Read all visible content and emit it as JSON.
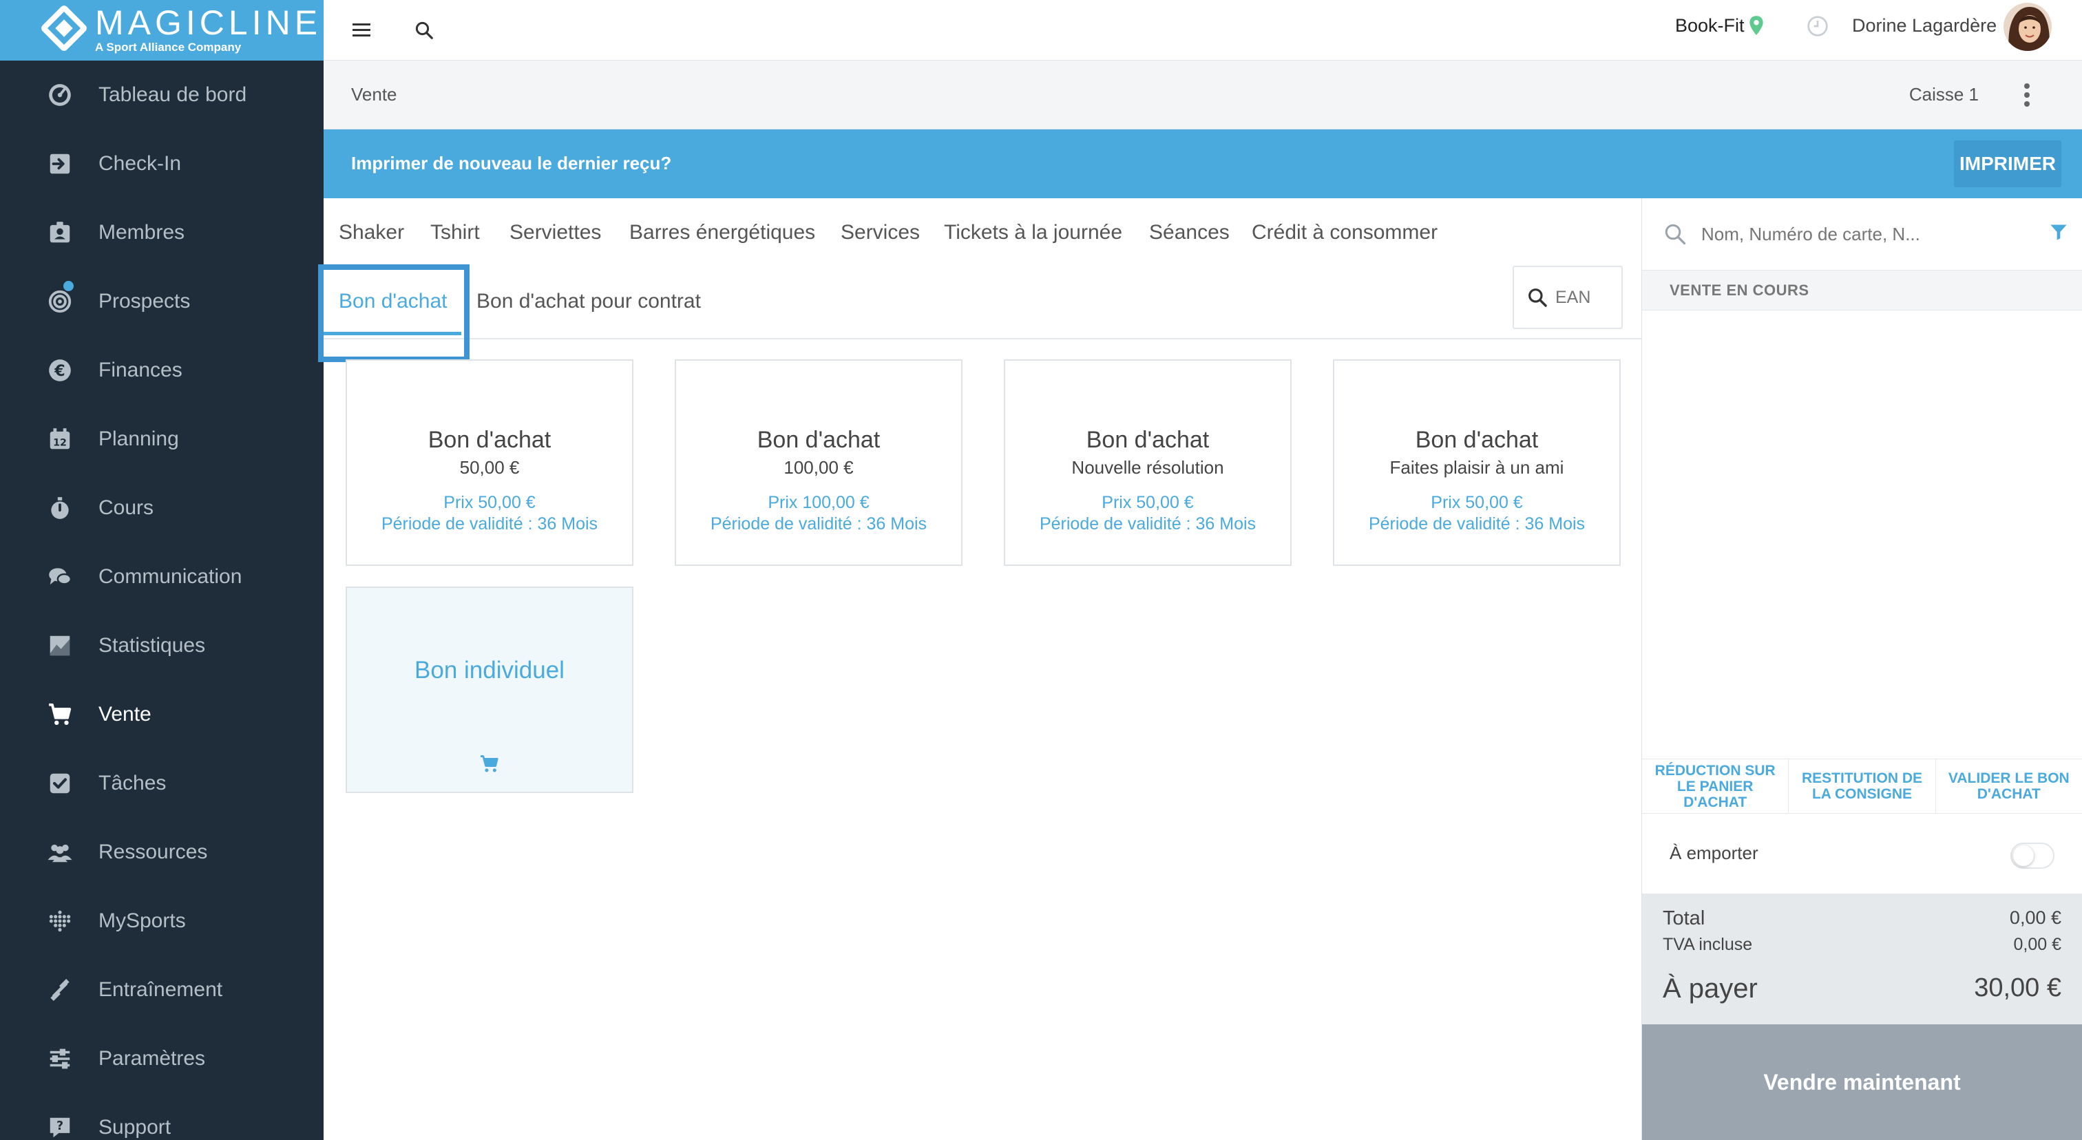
{
  "brand": {
    "name": "MAGICLINE",
    "tagline": "A Sport Alliance Company",
    "accent_color": "#4aaade"
  },
  "sidebar": {
    "items": [
      {
        "label": "Tableau de bord",
        "icon": "dashboard-icon"
      },
      {
        "label": "Check-In",
        "icon": "check-in-icon"
      },
      {
        "label": "Membres",
        "icon": "members-icon"
      },
      {
        "label": "Prospects",
        "icon": "prospects-icon",
        "notification_dot": true
      },
      {
        "label": "Finances",
        "icon": "euro-icon"
      },
      {
        "label": "Planning",
        "icon": "calendar-icon"
      },
      {
        "label": "Cours",
        "icon": "stopwatch-icon"
      },
      {
        "label": "Communication",
        "icon": "chat-icon"
      },
      {
        "label": "Statistiques",
        "icon": "chart-icon"
      },
      {
        "label": "Vente",
        "icon": "cart-icon",
        "active": true
      },
      {
        "label": "Tâches",
        "icon": "checkbox-icon"
      },
      {
        "label": "Ressources",
        "icon": "people-icon"
      },
      {
        "label": "MySports",
        "icon": "dots-grid-icon"
      },
      {
        "label": "Entraînement",
        "icon": "dumbbell-icon"
      },
      {
        "label": "Paramètres",
        "icon": "sliders-icon"
      },
      {
        "label": "Support",
        "icon": "support-icon"
      }
    ]
  },
  "topbar": {
    "studio": "Book-Fit",
    "user_name": "Dorine Lagardère"
  },
  "subheader": {
    "title": "Vente",
    "register": "Caisse 1"
  },
  "banner": {
    "text": "Imprimer de nouveau le dernier reçu?",
    "button": "IMPRIMER"
  },
  "categories": {
    "row1": [
      "Shaker",
      "Tshirt",
      "Serviettes",
      "Barres énergétiques",
      "Services",
      "Tickets à la journée",
      "Séances",
      "Crédit à consommer"
    ],
    "row2": [
      "Bon d'achat",
      "Bon d'achat pour contrat"
    ],
    "active": "Bon d'achat",
    "ean_placeholder": "EAN"
  },
  "products": [
    {
      "title": "Bon d'achat",
      "subtitle": "50,00 €",
      "price": "Prix 50,00 €",
      "validity": "Période de validité : 36 Mois"
    },
    {
      "title": "Bon d'achat",
      "subtitle": "100,00 €",
      "price": "Prix 100,00 €",
      "validity": "Période de validité : 36 Mois"
    },
    {
      "title": "Bon d'achat",
      "subtitle": "Nouvelle résolution",
      "price": "Prix 50,00 €",
      "validity": "Période de validité : 36 Mois"
    },
    {
      "title": "Bon d'achat",
      "subtitle": "Faites plaisir à un ami",
      "price": "Prix 50,00 €",
      "validity": "Période de validité : 36 Mois"
    }
  ],
  "custom_product": {
    "title": "Bon individuel"
  },
  "cart": {
    "search_placeholder": "Nom, Numéro de carte, N...",
    "section_title": "VENTE EN COURS",
    "actions": [
      "RÉDUCTION SUR LE PANIER D'ACHAT",
      "RESTITUTION DE LA CONSIGNE",
      "VALIDER LE BON D'ACHAT"
    ],
    "takeaway_label": "À emporter",
    "takeaway_enabled": false,
    "total_label": "Total",
    "total_value": "0,00 €",
    "vat_label": "TVA incluse",
    "vat_value": "0,00 €",
    "to_pay_label": "À payer",
    "to_pay_value": "30,00 €",
    "checkout_button": "Vendre maintenant"
  }
}
